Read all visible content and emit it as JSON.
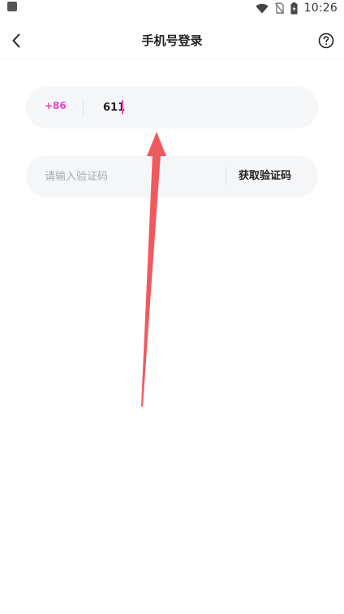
{
  "status_bar": {
    "time": "10:26",
    "icons": [
      "notification-square-icon",
      "wifi-icon",
      "no-sim-icon",
      "battery-charging-icon"
    ]
  },
  "header": {
    "title": "手机号登录",
    "back_icon": "chevron-left-icon",
    "help_icon": "help-circle-icon"
  },
  "phone_field": {
    "country_code": "+86",
    "value": "611"
  },
  "code_field": {
    "placeholder": "请输入验证码",
    "get_code_label": "获取验证码"
  },
  "colors": {
    "accent": "#e545c8",
    "field_background": "#f5f6f8",
    "annotation_arrow": "#f05a5f"
  }
}
